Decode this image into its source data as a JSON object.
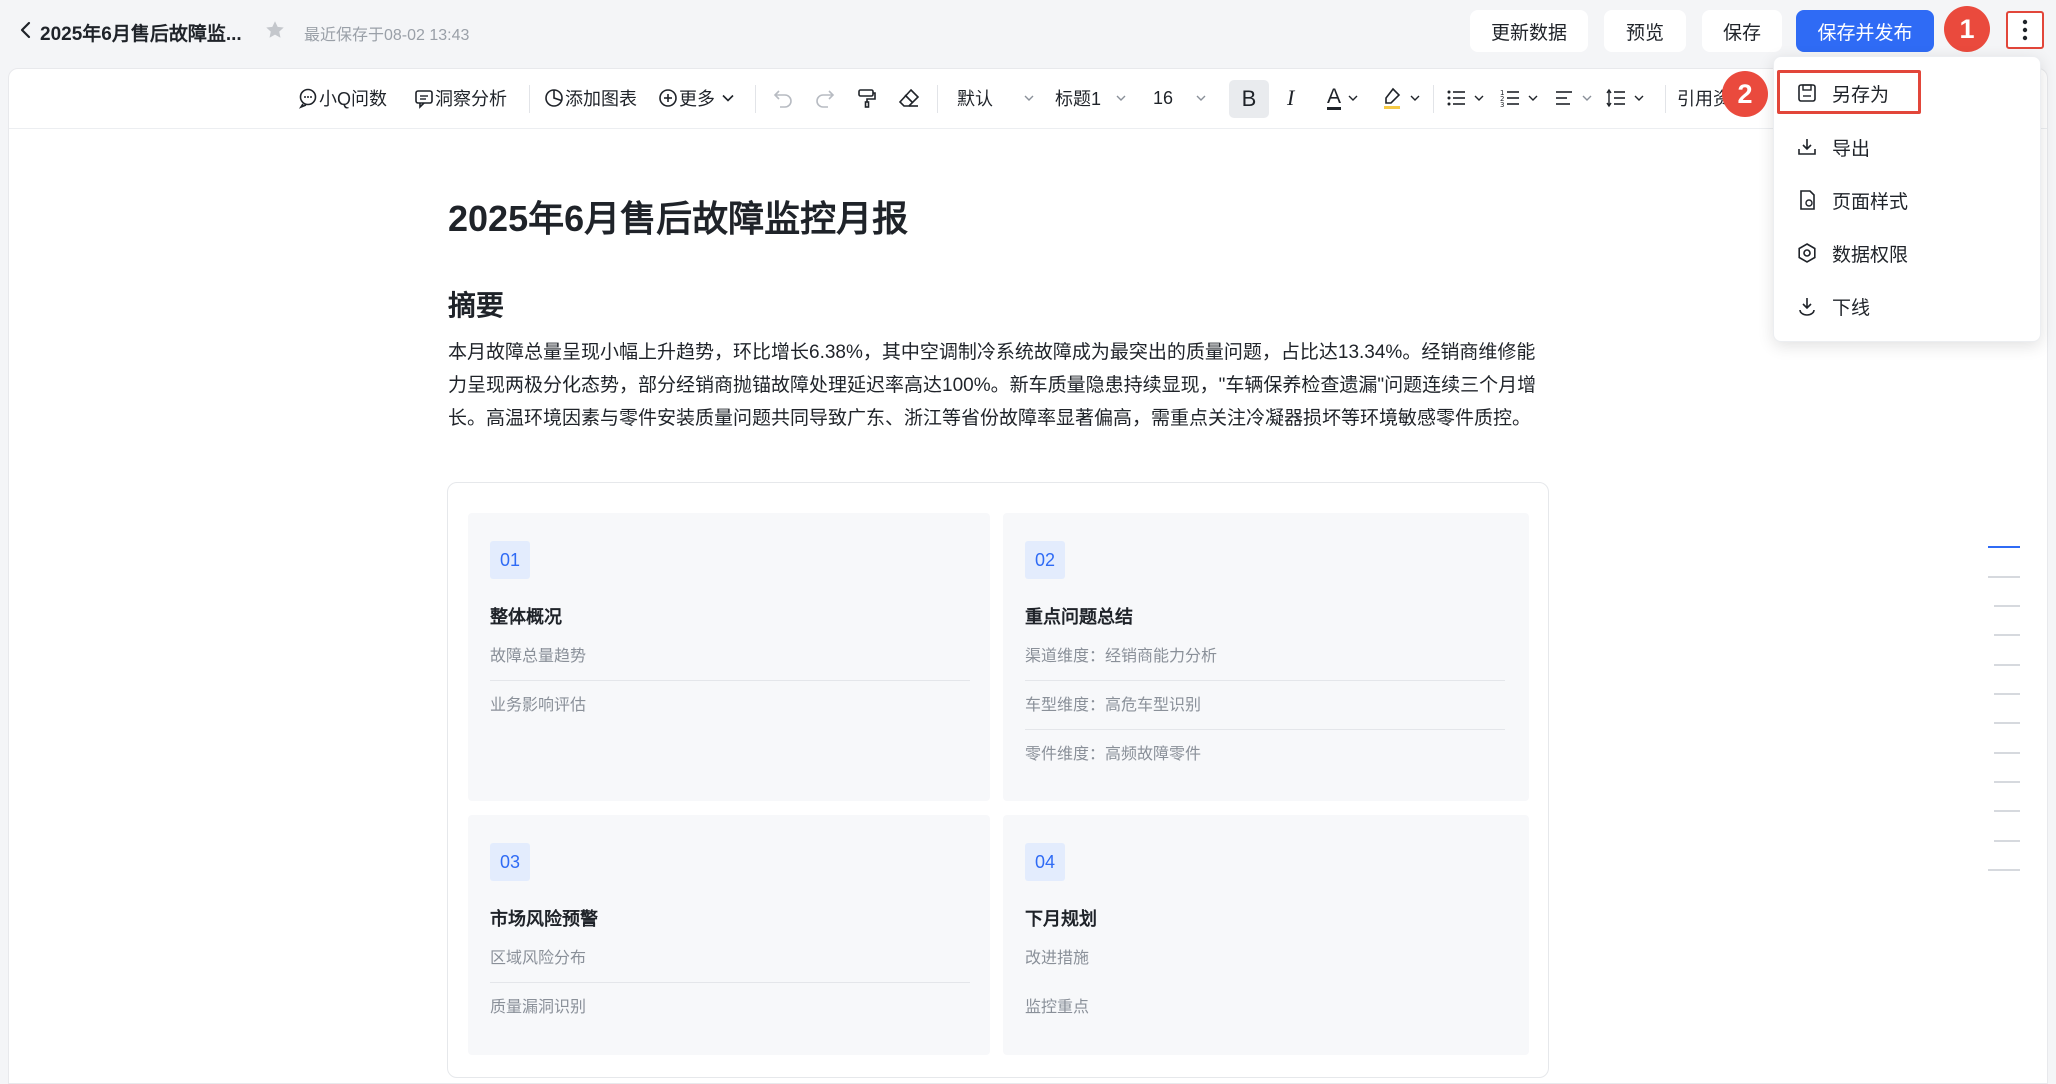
{
  "header": {
    "title": "2025年6月售后故障监...",
    "save_status": "最近保存于08-02 13:43",
    "buttons": {
      "update": "更新数据",
      "preview": "预览",
      "save": "保存",
      "save_publish": "保存并发布"
    },
    "badge_1": "1",
    "badge_2": "2"
  },
  "toolbar": {
    "ask": "小Q问数",
    "insight": "洞察分析",
    "add_chart": "添加图表",
    "more": "更多",
    "style": "默认",
    "heading": "标题1",
    "font_size": "16",
    "bold": "B",
    "italic": "I",
    "font_color": "A",
    "cite": "引用资"
  },
  "menu": {
    "items": [
      "另存为",
      "导出",
      "页面样式",
      "数据权限",
      "下线"
    ]
  },
  "doc": {
    "title": "2025年6月售后故障监控月报",
    "section": "摘要",
    "summary": "本月故障总量呈现小幅上升趋势，环比增长6.38%，其中空调制冷系统故障成为最突出的质量问题，占比达13.34%。经销商维修能力呈现两极分化态势，部分经销商抛锚故障处理延迟率高达100%。新车质量隐患持续显现，\"车辆保养检查遗漏\"问题连续三个月增长。高温环境因素与零件安装质量问题共同导致广东、浙江等省份故障率显著偏高，需重点关注冷凝器损坏等环境敏感零件质控。",
    "cards": [
      {
        "num": "01",
        "title": "整体概况",
        "items": [
          "故障总量趋势",
          "业务影响评估"
        ]
      },
      {
        "num": "02",
        "title": "重点问题总结",
        "items": [
          "渠道维度：经销商能力分析",
          "车型维度：高危车型识别",
          "零件维度：高频故障零件"
        ]
      },
      {
        "num": "03",
        "title": "市场风险预警",
        "items": [
          "区域风险分布",
          "质量漏洞识别"
        ]
      },
      {
        "num": "04",
        "title": "下月规划",
        "items": [
          "改进措施",
          "监控重点"
        ]
      }
    ]
  }
}
